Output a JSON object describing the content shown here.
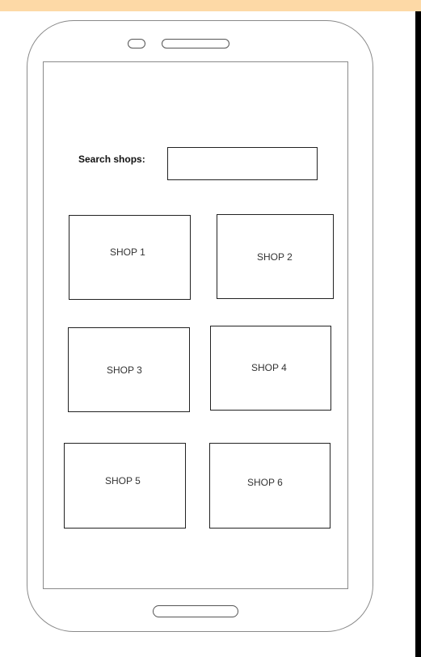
{
  "search": {
    "label": "Search shops:",
    "value": "",
    "placeholder": ""
  },
  "shops": [
    {
      "label": "SHOP 1"
    },
    {
      "label": "SHOP 2"
    },
    {
      "label": "SHOP 3"
    },
    {
      "label": "SHOP 4"
    },
    {
      "label": "SHOP 5"
    },
    {
      "label": "SHOP 6"
    }
  ],
  "colors": {
    "top_band": "#fdd9a6",
    "right_bar": "#000000",
    "outline": "#8a8a8a",
    "box_border": "#222222"
  }
}
